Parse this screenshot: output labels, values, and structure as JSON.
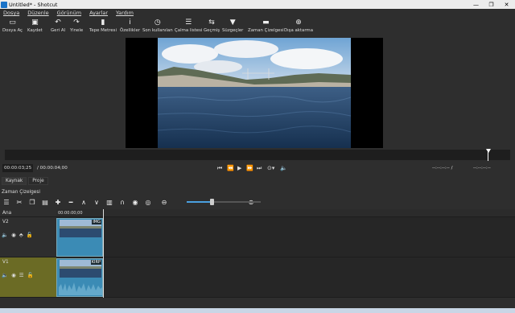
{
  "window": {
    "title": "Untitled* - Shotcut",
    "min": "—",
    "max": "❐",
    "close": "✕"
  },
  "menu": [
    "Dosya",
    "Düzenle",
    "Görünüm",
    "Ayarlar",
    "Yardım"
  ],
  "toolbar": [
    {
      "label": "Dosya Aç",
      "icon": "folder-open-icon",
      "glyph": "▭"
    },
    {
      "label": "Kaydet",
      "icon": "save-icon",
      "glyph": "▣"
    },
    {
      "label": "Geri Al",
      "icon": "undo-icon",
      "glyph": "↶"
    },
    {
      "label": "Yinele",
      "icon": "redo-icon",
      "glyph": "↷"
    },
    {
      "label": "Tepe Metresi",
      "icon": "peak-meter-icon",
      "glyph": "▮"
    },
    {
      "label": "Özellikler",
      "icon": "info-icon",
      "glyph": "i"
    },
    {
      "label": "Son kullanılan",
      "icon": "clock-icon",
      "glyph": "◷"
    },
    {
      "label": "Çalma listesi",
      "icon": "playlist-icon",
      "glyph": "☰"
    },
    {
      "label": "Geçmiş",
      "icon": "history-icon",
      "glyph": "⇆"
    },
    {
      "label": "Süzgeçler",
      "icon": "filter-icon",
      "glyph": "▼"
    },
    {
      "label": "Zaman Çizelgesi",
      "icon": "timeline-icon",
      "glyph": "▬"
    },
    {
      "label": "Dışa aktarma",
      "icon": "export-icon",
      "glyph": "⊕"
    }
  ],
  "transport": {
    "position": "00:00:03;25",
    "duration": "/ 00:00:04;00",
    "in_point": "--:--:--:-- /",
    "out_point": "--:--:--:--"
  },
  "tabs": {
    "source": "Kaynak",
    "project": "Proje"
  },
  "timeline": {
    "title": "Zaman Çizelgesi",
    "ruler_time": "00:00:00;00",
    "master_label": "Ana",
    "tracks": [
      {
        "name": "V2",
        "clip_label": "IMG"
      },
      {
        "name": "V1",
        "clip_label": "KIRP"
      }
    ]
  },
  "colors": {
    "accent": "#4aa0e0",
    "clip": "#3b8bb5",
    "selected_track": "#6b6b25"
  }
}
